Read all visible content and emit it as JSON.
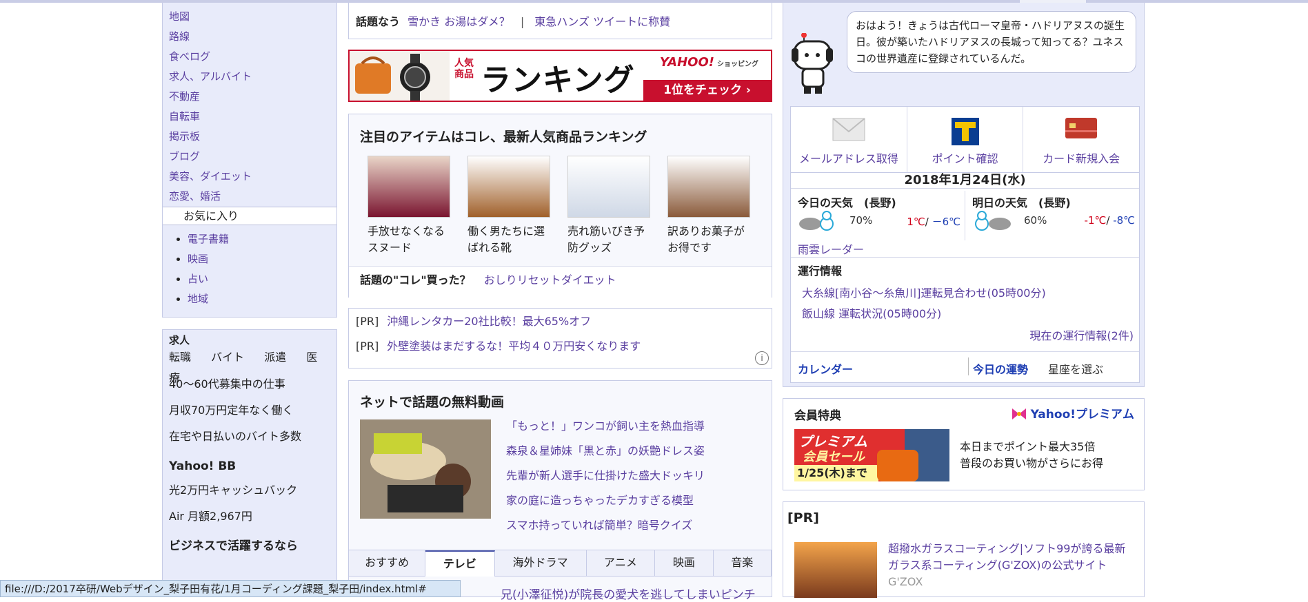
{
  "left": {
    "services": [
      "地図",
      "路線",
      "食べログ",
      "求人、アルバイト",
      "不動産",
      "自転車",
      "掲示板",
      "ブログ",
      "美容、ダイエット",
      "恋愛、婚活"
    ],
    "favorites_heading": "お気に入り",
    "favorites": [
      "電子書籍",
      "映画",
      "占い",
      "地域"
    ],
    "jobs": {
      "heading": "求人",
      "tags": [
        "転職",
        "バイト",
        "派遣",
        "医療"
      ],
      "lines": [
        "40～60代募集中の仕事",
        "月収70万円定年なく働く",
        "在宅や日払いのバイト多数"
      ],
      "bb_heading": "Yahoo! BB",
      "bb_lines": [
        "光2万円キャッシュバック",
        "Air 月額2,967円"
      ],
      "biz_heading": "ビジネスで活躍するなら"
    }
  },
  "center": {
    "topics": {
      "label": "話題なう",
      "items": [
        "雪かき お湯はダメ？",
        "東急ハンズ ツイートに称賛"
      ],
      "sep": "|"
    },
    "banner": {
      "pre_line1": "人気",
      "pre_line2": "商品",
      "title": "ランキング",
      "brand": "YAHOO!",
      "brand_sub": "ショッピング",
      "cta": "1位をチェック ›"
    },
    "ranking": {
      "heading": "注目のアイテムはコレ、最新人気商品ランキング",
      "items": [
        {
          "caption": "手放せなくなるスヌード"
        },
        {
          "caption": "働く男たちに選ばれる靴"
        },
        {
          "caption": "売れ筋いびき予防グッズ"
        },
        {
          "caption": "訳ありお菓子がお得です"
        }
      ],
      "footer_label": "話題の\"コレ\"買った？",
      "footer_link": "おしりリセットダイエット"
    },
    "pr": {
      "tag": "[PR]",
      "items": [
        "沖縄レンタカー20社比較！最大65%オフ",
        "外壁塗装はまだするな！平均４０万円安くなります"
      ],
      "info_icon": "i"
    },
    "video": {
      "heading": "ネットで話題の無料動画",
      "items": [
        "「もっと！」ワンコが飼い主を熱血指導",
        "森泉＆星姉妹「黒と赤」の妖艶ドレス姿",
        "先輩が新人選手に仕掛けた盛大ドッキリ",
        "家の庭に造っちゃったデカすぎる模型",
        "スマホ持っていれば簡単？暗号クイズ"
      ],
      "tabs": [
        "おすすめ",
        "テレビ",
        "海外ドラマ",
        "アニメ",
        "映画",
        "音楽"
      ],
      "active_tab": "テレビ",
      "next_item": "兄(小澤征悦)が院長の愛犬を逃してしまいピンチ"
    }
  },
  "right": {
    "greeting": "おはよう！きょうは古代ローマ皇帝・ハドリアヌスの誕生日。彼が築いたハドリアヌスの長城って知ってる？ユネスコの世界遺産に登録されているんだ。",
    "services": [
      {
        "label": "メールアドレス取得",
        "icon": "envelope-icon"
      },
      {
        "label": "ポイント確認",
        "icon": "tpoint-icon"
      },
      {
        "label": "カード新規入会",
        "icon": "credit-card-icon"
      }
    ],
    "date": "2018年1月24日(水)",
    "weather_today": {
      "title": "今日の天気　(長野)",
      "precip": "70%",
      "high": "1℃",
      "sep": "/",
      "low": "－6℃"
    },
    "weather_tomorrow": {
      "title": "明日の天気　(長野)",
      "precip": "60%",
      "high": "-1℃",
      "sep": "/",
      "low": "-8℃"
    },
    "radar": "雨雲レーダー",
    "train": {
      "heading": "運行情報",
      "lines": [
        "大糸線[南小谷～糸魚川]運転見合わせ(05時00分)",
        "飯山線 運転状況(05時00分)"
      ],
      "current": "現在の運行情報(2件)"
    },
    "calendar": "カレンダー",
    "fortune": "今日の運勢",
    "zodiac": "星座を選ぶ",
    "premium": {
      "heading": "会員特典",
      "brand": "Yahoo!プレミアム",
      "img_line1": "プレミアム",
      "img_line2": "会員セール",
      "img_line3": "1/25(木)まで",
      "text1": "本日までポイント最大35倍",
      "text2": "普段のお買い物がさらにお得"
    },
    "pr2": {
      "heading": "[PR]",
      "text": "超撥水ガラスコーティング|ソフト99が誇る最新ガラス系コーティング(G'ZOX)の公式サイト",
      "sub": "G'ZOX"
    }
  },
  "statusbar": "file:///D:/2017卒研/Webデザイン_梨子田有花/1月コーディング課題_梨子田/index.html#",
  "colors": {
    "link": "#5a3fa0",
    "accent_red": "#c8102e",
    "panel_bg": "#e8ebfa",
    "border": "#c6cbe6"
  }
}
